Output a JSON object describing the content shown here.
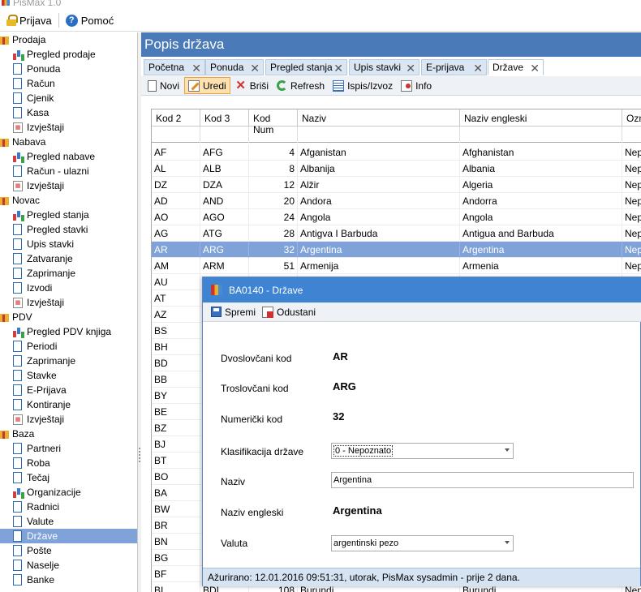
{
  "app": {
    "title": "PisMax 1.0"
  },
  "menu": {
    "login": "Prijava",
    "help": "Pomoć"
  },
  "sidebar": {
    "groups": [
      {
        "label": "Prodaja",
        "items": [
          {
            "label": "Pregled prodaje",
            "icon": "chart-icon"
          },
          {
            "label": "Ponuda",
            "icon": "document-icon"
          },
          {
            "label": "Račun",
            "icon": "document-icon"
          },
          {
            "label": "Cjenik",
            "icon": "document-icon"
          },
          {
            "label": "Kasa",
            "icon": "document-icon"
          },
          {
            "label": "Izvještaji",
            "icon": "report-icon"
          }
        ]
      },
      {
        "label": "Nabava",
        "items": [
          {
            "label": "Pregled nabave",
            "icon": "chart-icon"
          },
          {
            "label": "Račun - ulazni",
            "icon": "document-icon"
          },
          {
            "label": "Izvještaji",
            "icon": "report-icon"
          }
        ]
      },
      {
        "label": "Novac",
        "items": [
          {
            "label": "Pregled stanja",
            "icon": "chart-icon"
          },
          {
            "label": "Pregled stavki",
            "icon": "document-icon"
          },
          {
            "label": "Upis stavki",
            "icon": "document-icon"
          },
          {
            "label": "Zatvaranje",
            "icon": "document-icon"
          },
          {
            "label": "Zaprimanje",
            "icon": "document-icon"
          },
          {
            "label": "Izvodi",
            "icon": "document-icon"
          },
          {
            "label": "Izvještaji",
            "icon": "report-icon"
          }
        ]
      },
      {
        "label": "PDV",
        "items": [
          {
            "label": "Pregled PDV knjiga",
            "icon": "chart-icon"
          },
          {
            "label": "Periodi",
            "icon": "document-icon"
          },
          {
            "label": "Zaprimanje",
            "icon": "document-icon"
          },
          {
            "label": "Stavke",
            "icon": "document-icon"
          },
          {
            "label": "E-Prijava",
            "icon": "document-icon"
          },
          {
            "label": "Kontiranje",
            "icon": "document-icon"
          },
          {
            "label": "Izvještaji",
            "icon": "report-icon"
          }
        ]
      },
      {
        "label": "Baza",
        "items": [
          {
            "label": "Partneri",
            "icon": "document-icon"
          },
          {
            "label": "Roba",
            "icon": "document-icon"
          },
          {
            "label": "Tečaj",
            "icon": "document-icon"
          },
          {
            "label": "Organizacije",
            "icon": "chart-icon"
          },
          {
            "label": "Radnici",
            "icon": "document-icon"
          },
          {
            "label": "Valute",
            "icon": "document-icon"
          },
          {
            "label": "Države",
            "icon": "document-icon",
            "selected": true
          },
          {
            "label": "Pošte",
            "icon": "document-icon"
          },
          {
            "label": "Naselje",
            "icon": "document-icon"
          },
          {
            "label": "Banke",
            "icon": "document-icon"
          }
        ]
      }
    ]
  },
  "main": {
    "title": "Popis država",
    "tabs": [
      {
        "label": "Početna"
      },
      {
        "label": "Ponuda"
      },
      {
        "label": "Pregled stanja"
      },
      {
        "label": "Upis stavki"
      },
      {
        "label": "E-prijava"
      },
      {
        "label": "Države",
        "active": true
      }
    ],
    "toolbar": {
      "new": "Novi",
      "edit": "Uredi",
      "delete": "Briši",
      "refresh": "Refresh",
      "print": "Ispis/Izvoz",
      "info": "Info"
    }
  },
  "grid": {
    "columns": [
      "Kod 2",
      "Kod 3",
      "Kod Num",
      "Naziv",
      "Naziv engleski",
      "Ozn"
    ],
    "rows": [
      {
        "k2": "AF",
        "k3": "AFG",
        "num": "4",
        "naziv": "Afganistan",
        "eng": "Afghanistan",
        "ozn": "Nep"
      },
      {
        "k2": "AL",
        "k3": "ALB",
        "num": "8",
        "naziv": "Albanija",
        "eng": "Albania",
        "ozn": "Nep"
      },
      {
        "k2": "DZ",
        "k3": "DZA",
        "num": "12",
        "naziv": "Alžir",
        "eng": "Algeria",
        "ozn": "Nep"
      },
      {
        "k2": "AD",
        "k3": "AND",
        "num": "20",
        "naziv": "Andora",
        "eng": "Andorra",
        "ozn": "Nep"
      },
      {
        "k2": "AO",
        "k3": "AGO",
        "num": "24",
        "naziv": "Angola",
        "eng": "Angola",
        "ozn": "Nep"
      },
      {
        "k2": "AG",
        "k3": "ATG",
        "num": "28",
        "naziv": "Antigva I Barbuda",
        "eng": "Antigua and Barbuda",
        "ozn": "Nep"
      },
      {
        "k2": "AR",
        "k3": "ARG",
        "num": "32",
        "naziv": "Argentina",
        "eng": "Argentina",
        "ozn": "Nep",
        "selected": true
      },
      {
        "k2": "AM",
        "k3": "ARM",
        "num": "51",
        "naziv": "Armenija",
        "eng": "Armenia",
        "ozn": "Nep"
      },
      {
        "k2": "AU",
        "k3": "",
        "num": "",
        "naziv": "",
        "eng": "",
        "ozn": ""
      },
      {
        "k2": "AT",
        "k3": "",
        "num": "",
        "naziv": "",
        "eng": "",
        "ozn": ""
      },
      {
        "k2": "AZ",
        "k3": "",
        "num": "",
        "naziv": "",
        "eng": "",
        "ozn": ""
      },
      {
        "k2": "BS",
        "k3": "",
        "num": "",
        "naziv": "",
        "eng": "",
        "ozn": ""
      },
      {
        "k2": "BH",
        "k3": "",
        "num": "",
        "naziv": "",
        "eng": "",
        "ozn": ""
      },
      {
        "k2": "BD",
        "k3": "",
        "num": "",
        "naziv": "",
        "eng": "",
        "ozn": ""
      },
      {
        "k2": "BB",
        "k3": "",
        "num": "",
        "naziv": "",
        "eng": "",
        "ozn": ""
      },
      {
        "k2": "BY",
        "k3": "",
        "num": "",
        "naziv": "",
        "eng": "",
        "ozn": ""
      },
      {
        "k2": "BE",
        "k3": "",
        "num": "",
        "naziv": "",
        "eng": "",
        "ozn": ""
      },
      {
        "k2": "BZ",
        "k3": "",
        "num": "",
        "naziv": "",
        "eng": "",
        "ozn": ""
      },
      {
        "k2": "BJ",
        "k3": "",
        "num": "",
        "naziv": "",
        "eng": "",
        "ozn": ""
      },
      {
        "k2": "BT",
        "k3": "",
        "num": "",
        "naziv": "",
        "eng": "",
        "ozn": ""
      },
      {
        "k2": "BO",
        "k3": "",
        "num": "",
        "naziv": "",
        "eng": "",
        "ozn": ""
      },
      {
        "k2": "BA",
        "k3": "",
        "num": "",
        "naziv": "",
        "eng": "",
        "ozn": ""
      },
      {
        "k2": "BW",
        "k3": "",
        "num": "",
        "naziv": "",
        "eng": "",
        "ozn": ""
      },
      {
        "k2": "BR",
        "k3": "",
        "num": "",
        "naziv": "",
        "eng": "",
        "ozn": ""
      },
      {
        "k2": "BN",
        "k3": "",
        "num": "",
        "naziv": "",
        "eng": "",
        "ozn": ""
      },
      {
        "k2": "BG",
        "k3": "",
        "num": "",
        "naziv": "",
        "eng": "",
        "ozn": ""
      },
      {
        "k2": "BF",
        "k3": "",
        "num": "",
        "naziv": "",
        "eng": "",
        "ozn": ""
      },
      {
        "k2": "BI",
        "k3": "BDI",
        "num": "108",
        "naziv": "Burundi",
        "eng": "Burundi",
        "ozn": "Nep"
      }
    ]
  },
  "dialog": {
    "title": "BA0140 - Države",
    "save": "Spremi",
    "cancel": "Odustani",
    "fields": {
      "kod2_label": "Dvoslovčani kod",
      "kod2_value": "AR",
      "kod3_label": "Troslovčani kod",
      "kod3_value": "ARG",
      "num_label": "Numerički kod",
      "num_value": "32",
      "klas_label": "Klasifikacija države",
      "klas_value": "0 - Nepoznato",
      "naziv_label": "Naziv",
      "naziv_value": "Argentina",
      "eng_label": "Naziv engleski",
      "eng_value": "Argentina",
      "valuta_label": "Valuta",
      "valuta_value": "argentinski pezo"
    },
    "status": "Ažurirano: 12.01.2016 09:51:31, utorak, PisMax sysadmin -  prije 2 dana."
  },
  "colors": {
    "header": "#4a7ab8",
    "selection": "#7fa2d9",
    "dialog_title": "#3f83d3"
  }
}
